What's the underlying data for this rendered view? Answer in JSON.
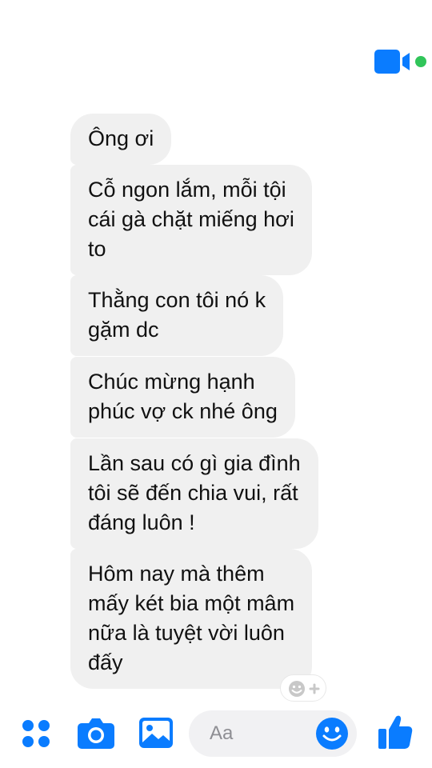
{
  "messages": [
    {
      "text": "Ông ơi"
    },
    {
      "text": "Cỗ ngon lắm, mỗi tội\ncái gà chặt miếng hơi\nto"
    },
    {
      "text": "Thằng con tôi nó k\ngặm dc"
    },
    {
      "text": "Chúc mừng hạnh\nphúc vợ ck nhé ông"
    },
    {
      "text": "Lần sau có gì gia đình\ntôi sẽ đến chia vui, rất\nđáng luôn !"
    },
    {
      "text": "Hôm nay mà thêm\nmấy két bia một mâm\nnữa là tuyệt vời luôn\nđấy"
    }
  ],
  "composer": {
    "placeholder": "Aa",
    "icons": [
      "more-apps-icon",
      "camera-icon",
      "gallery-icon",
      "emoji-icon",
      "like-icon"
    ]
  },
  "header": {
    "icons": [
      "video-call-icon",
      "online-status-dot"
    ]
  },
  "colors": {
    "accent": "#0a7cff",
    "online": "#31c55a",
    "bubble": "#f0f0f0"
  }
}
